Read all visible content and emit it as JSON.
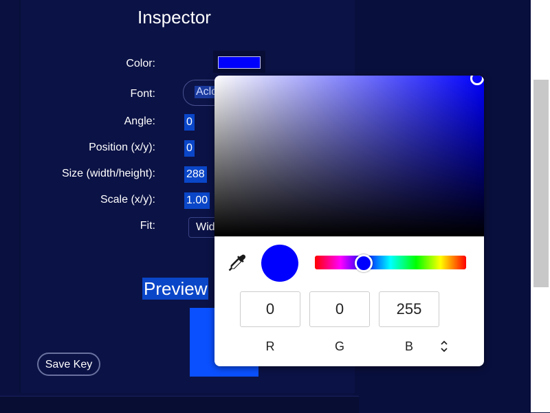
{
  "inspector": {
    "title": "Inspector",
    "labels": {
      "color": "Color:",
      "font": "Font:",
      "angle": "Angle:",
      "position": "Position (x/y):",
      "size": "Size (width/height):",
      "scale": "Scale (x/y):",
      "fit": "Fit:"
    },
    "values": {
      "font": "Acld",
      "angle": "0",
      "position_x": "0",
      "size_width": "288",
      "scale_x": "1.00",
      "fit": "Wid"
    },
    "color_value": "#0000ff",
    "preview_label": "Preview",
    "save_key_label": "Save Key"
  },
  "color_picker": {
    "r": "0",
    "g": "0",
    "b": "255",
    "labels": {
      "r": "R",
      "g": "G",
      "b": "B"
    },
    "hex": "#0000ff",
    "icons": [
      "eyedropper-icon",
      "unfold-icon"
    ]
  }
}
